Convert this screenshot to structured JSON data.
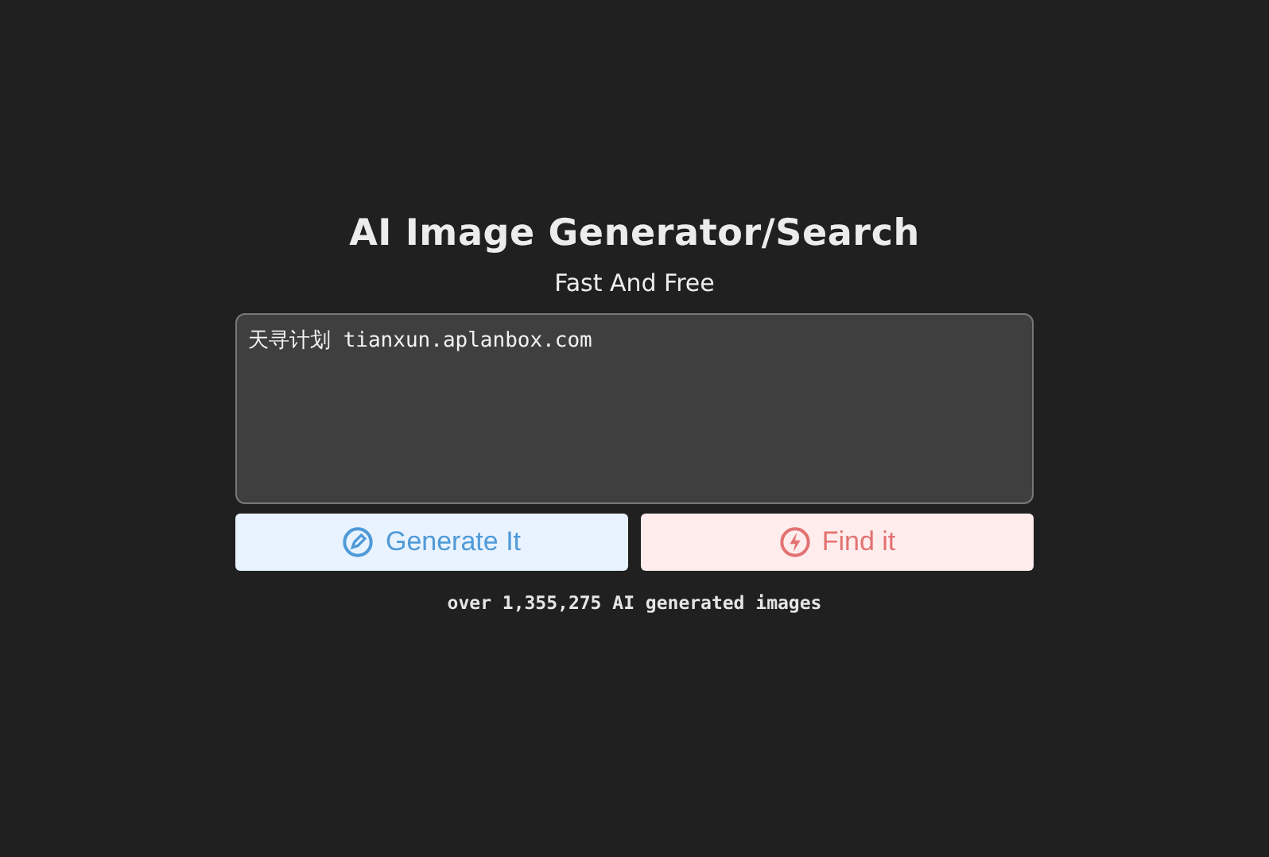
{
  "title": "AI Image Generator/Search",
  "subtitle": "Fast And Free",
  "prompt": {
    "value": "天寻计划 tianxun.aplanbox.com"
  },
  "buttons": [
    {
      "kind": "generate",
      "label": "Generate It"
    },
    {
      "kind": "find",
      "label": "Find it"
    }
  ],
  "count_note": "over 1,355,275 AI generated images"
}
